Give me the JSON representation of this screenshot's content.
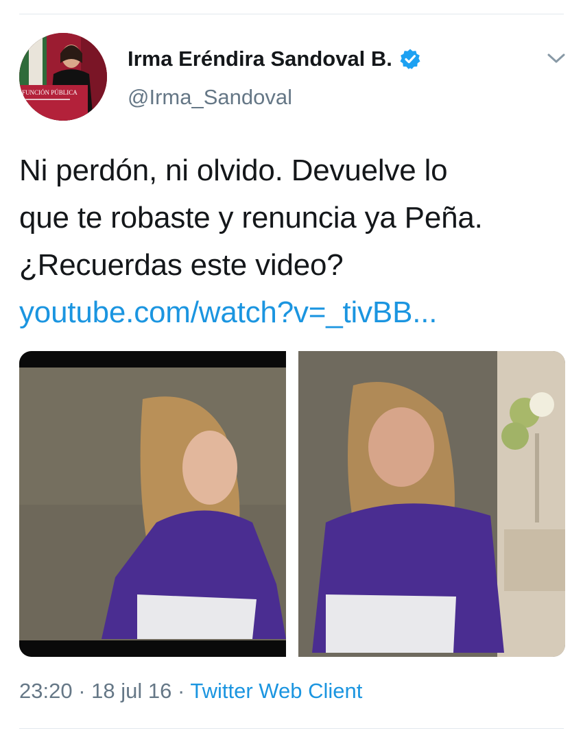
{
  "author": {
    "display_name": "Irma Eréndira Sandoval B.",
    "handle": "@Irma_Sandoval",
    "avatar_sign_text": "FUNCIÓN PÚBLICA"
  },
  "tweet": {
    "line1": "Ni perdón, ni olvido. Devuelve lo",
    "line2": "que te robaste y renuncia ya Peña.",
    "line3": "¿Recuerdas este video?",
    "link": "youtube.com/watch?v=_tivBB..."
  },
  "meta": {
    "time": "23:20",
    "separator": "·",
    "date": "18 jul 16",
    "source": "Twitter Web Client"
  },
  "colors": {
    "link": "#1b95e0",
    "secondary_text": "#657786",
    "verified": "#1da1f2",
    "jacket": "#4a2d91"
  },
  "icons": {
    "verified": "verified-badge-icon",
    "menu": "chevron-down-icon"
  }
}
